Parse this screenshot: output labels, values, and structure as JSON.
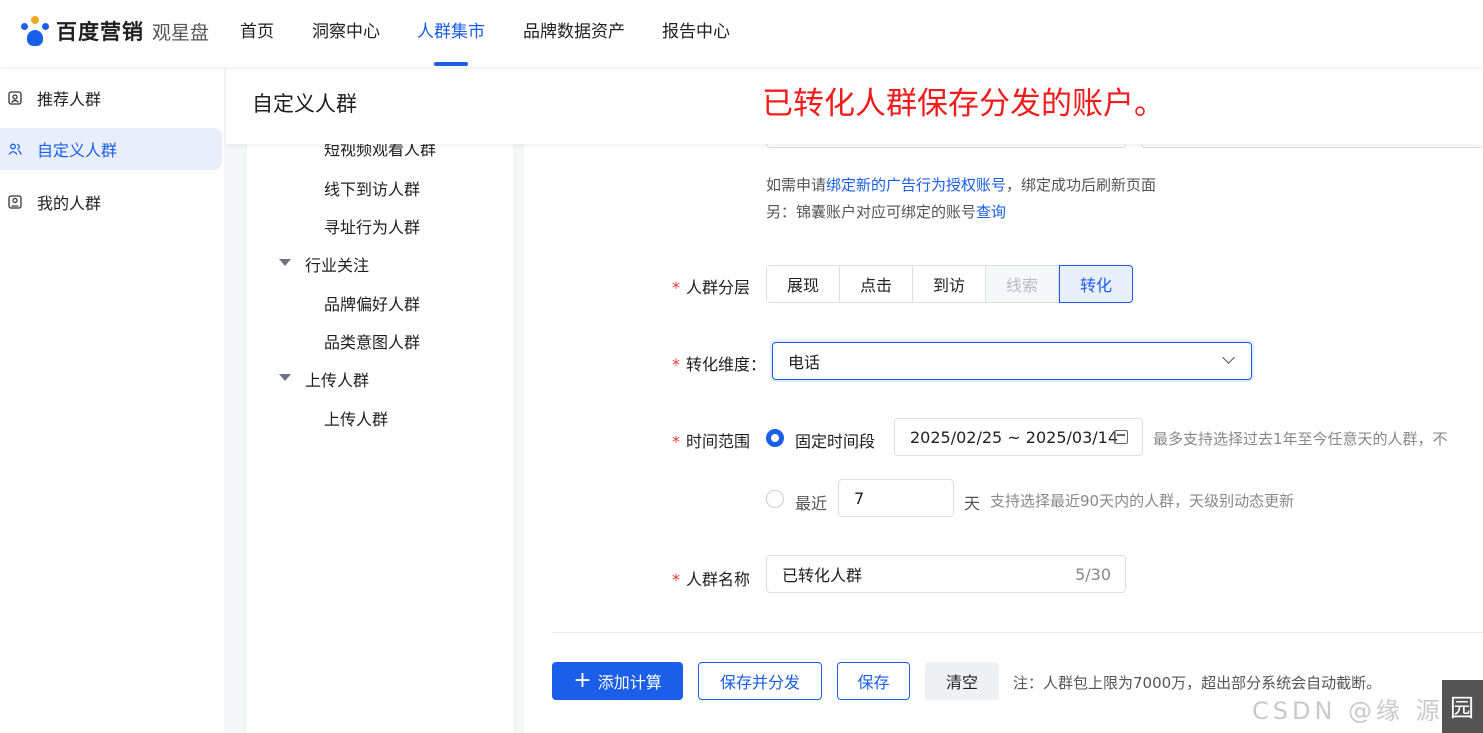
{
  "brand": {
    "name": "百度营销",
    "product": "观星盘"
  },
  "nav": {
    "items": [
      "首页",
      "洞察中心",
      "人群集市",
      "品牌数据资产",
      "报告中心"
    ],
    "active_index": 2
  },
  "sidebar": {
    "items": [
      {
        "label": "推荐人群",
        "icon": "recommend-icon"
      },
      {
        "label": "自定义人群",
        "icon": "users-icon"
      },
      {
        "label": "我的人群",
        "icon": "my-group-icon"
      }
    ],
    "active_index": 1
  },
  "header": {
    "title": "自定义人群",
    "annotation": "已转化人群保存分发的账户。"
  },
  "tree": {
    "cut_item": "短视频观看人群",
    "items_a": [
      "线下到访人群",
      "寻址行为人群"
    ],
    "group_industry": "行业关注",
    "items_b": [
      "品牌偏好人群",
      "品类意图人群"
    ],
    "group_upload": "上传人群",
    "items_c": [
      "上传人群"
    ]
  },
  "form": {
    "hint1_prefix": "如需申请",
    "hint1_link": "绑定新的广告行为授权账号",
    "hint1_suffix": "，绑定成功后刷新页面",
    "hint2_prefix": "另：锦囊账户对应可绑定的账号",
    "hint2_link": "查询",
    "required_mark": "*",
    "layer_label": "人群分层",
    "layers": [
      "展现",
      "点击",
      "到访",
      "线索",
      "转化"
    ],
    "layer_disabled_index": 3,
    "layer_active_index": 4,
    "dimension_label": "转化维度：",
    "dimension_value": "电话",
    "time_label": "时间范围",
    "fixed_label": "固定时间段",
    "date_range": "2025/02/25 ~ 2025/03/14",
    "fixed_hint": "最多支持选择过去1年至今任意天的人群，不",
    "recent_label": "最近",
    "recent_days": "7",
    "days_unit": "天",
    "recent_hint": "支持选择最近90天内的人群，天级别动态更新",
    "name_label": "人群名称",
    "name_value": "已转化人群",
    "name_counter": "5/30"
  },
  "footer": {
    "add_calc": "添加计算",
    "save_distribute": "保存并分发",
    "save": "保存",
    "clear": "清空",
    "note": "注：人群包上限为7000万，超出部分系统会自动截断。"
  },
  "watermark": {
    "text": "CSDN @缘  源",
    "box": "园"
  },
  "colors": {
    "accent": "#1a5eea",
    "annotation": "#f21c1c",
    "required": "#e53935"
  }
}
